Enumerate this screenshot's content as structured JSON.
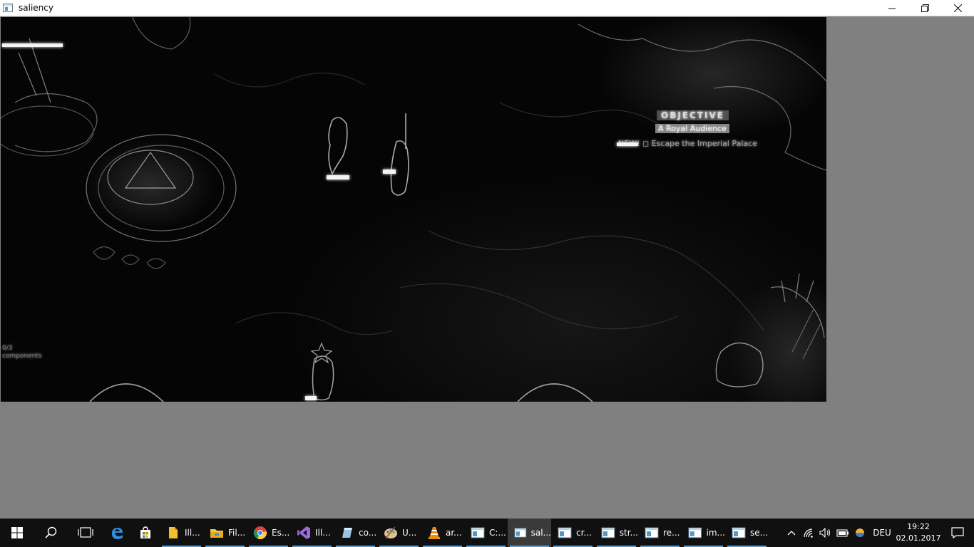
{
  "window": {
    "title": "saliency",
    "controls": {
      "minimize": "minimize-icon",
      "restore": "restore-icon",
      "close": "close-icon"
    }
  },
  "canvas": {
    "overlay_texts": {
      "quest_title": "OBJECTIVE",
      "quest_subtitle": "A Royal Audience",
      "quest_new": "NEW! ◻ Escape the Imperial Palace",
      "left_counter_1": "0/3",
      "left_counter_2": "components"
    }
  },
  "taskbar": {
    "start_icon": "windows-start-icon",
    "search_icon": "search-icon",
    "taskview_icon": "task-view-icon",
    "pinned": [
      {
        "icon": "edge-icon"
      },
      {
        "icon": "store-icon"
      }
    ],
    "apps": [
      {
        "icon": "folder-yellow-icon",
        "label": "Ill...",
        "running": true,
        "active": false
      },
      {
        "icon": "file-explorer-icon",
        "label": "Fil...",
        "running": true,
        "active": false
      },
      {
        "icon": "chrome-icon",
        "label": "Es...",
        "running": true,
        "active": false
      },
      {
        "icon": "visual-studio-icon",
        "label": "Ill...",
        "running": true,
        "active": false
      },
      {
        "icon": "app-cube-icon",
        "label": "co...",
        "running": true,
        "active": false
      },
      {
        "icon": "paint-palette-icon",
        "label": "U...",
        "running": true,
        "active": false
      },
      {
        "icon": "vlc-icon",
        "label": "ar...",
        "running": true,
        "active": false
      },
      {
        "icon": "window-app-icon",
        "label": "C:...",
        "running": true,
        "active": false
      },
      {
        "icon": "window-app-icon",
        "label": "sal...",
        "running": true,
        "active": true
      },
      {
        "icon": "window-app-icon",
        "label": "cr...",
        "running": true,
        "active": false
      },
      {
        "icon": "window-app-icon",
        "label": "str...",
        "running": true,
        "active": false
      },
      {
        "icon": "window-app-icon",
        "label": "re...",
        "running": true,
        "active": false
      },
      {
        "icon": "window-app-icon",
        "label": "im...",
        "running": true,
        "active": false
      },
      {
        "icon": "window-app-icon",
        "label": "se...",
        "running": true,
        "active": false
      }
    ],
    "tray": {
      "chevron_icon": "chevron-up-icon",
      "network_icon": "wifi-icon",
      "volume_icon": "speaker-icon",
      "battery_icon": "battery-icon",
      "app_icon": "colorful-ball-icon",
      "language": "DEU",
      "time": "19:22",
      "date": "02.01.2017",
      "notification_icon": "action-center-icon"
    }
  },
  "colors": {
    "desktop_bg": "#808080",
    "taskbar_bg": "#101010",
    "running_indicator": "#5a9fd6",
    "active_app_bg": "#3a3a3a"
  }
}
